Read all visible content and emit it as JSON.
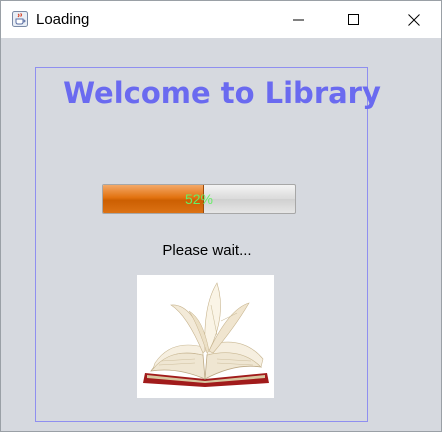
{
  "window": {
    "title": "Loading",
    "icons": {
      "app": "java-coffee-icon",
      "minimize": "minimize-icon",
      "maximize": "maximize-icon",
      "close": "close-icon"
    }
  },
  "content": {
    "headline": "Welcome to Library",
    "progress": {
      "value_percent": 52,
      "label": "52%"
    },
    "status_text": "Please wait...",
    "image": "open-book-icon"
  },
  "colors": {
    "headline": "#6a6af0",
    "panel_border": "#8f8ff0",
    "progress_fill": "#e2720f",
    "progress_text": "#66ef66",
    "background": "#d6d9df"
  }
}
